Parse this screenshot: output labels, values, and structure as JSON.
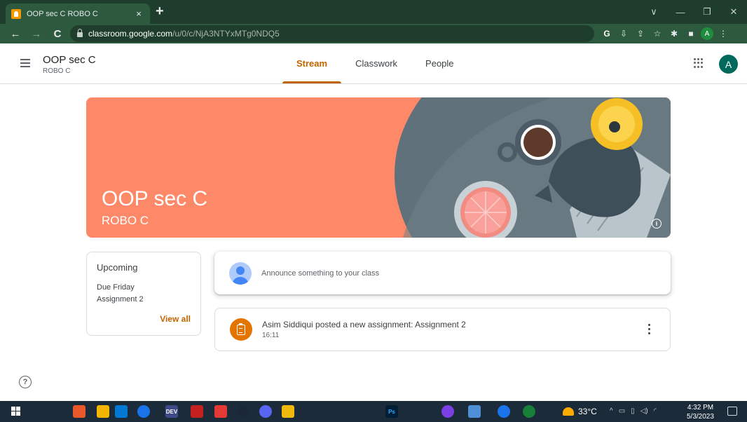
{
  "browser": {
    "tab_title": "OOP sec C ROBO C",
    "tab_close": "×",
    "new_tab": "+",
    "url_host": "classroom.google.com",
    "url_path": "/u/0/c/NjA3NTYxMTg0NDQ5",
    "back": "←",
    "forward": "→",
    "reload": "C",
    "profile_initial": "A",
    "window_controls": [
      "∨",
      "—",
      "❐",
      "✕"
    ]
  },
  "header": {
    "class_name": "OOP sec C",
    "section": "ROBO C",
    "tabs": [
      {
        "label": "Stream",
        "active": true
      },
      {
        "label": "Classwork",
        "active": false
      },
      {
        "label": "People",
        "active": false
      }
    ],
    "avatar_initial": "A"
  },
  "banner": {
    "title": "OOP sec C",
    "subtitle": "ROBO C",
    "info_glyph": "i"
  },
  "upcoming": {
    "title": "Upcoming",
    "due": "Due Friday",
    "assignment": "Assignment 2",
    "view_all": "View all"
  },
  "announce": {
    "placeholder": "Announce something to your class"
  },
  "posts": [
    {
      "text": "Asim Siddiqui posted a new assignment: Assignment 2",
      "time": "16:11"
    }
  ],
  "help_glyph": "?",
  "taskbar": {
    "weather": "33°C",
    "time": "4:32 PM",
    "date": "5/3/2023",
    "dev_label": "DEV",
    "devcpp_label": "DEV C++",
    "ps_label": "Ps",
    "tray_up": "^"
  },
  "colors": {
    "accent": "#c26401",
    "banner": "#fe8969",
    "assignment_icon": "#e37400",
    "browser_frame": "#1f3d2c"
  }
}
